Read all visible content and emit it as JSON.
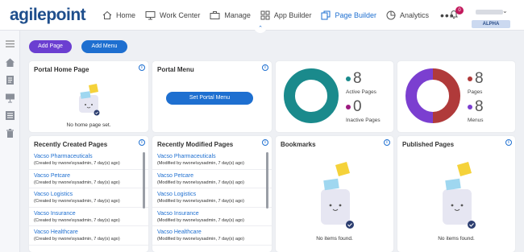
{
  "app": {
    "logo_text": "agilepoint",
    "logo_dot_color": "#1e4e8c"
  },
  "nav": {
    "items": [
      {
        "label": "Home",
        "icon": "home-icon",
        "active": false
      },
      {
        "label": "Work Center",
        "icon": "monitor-icon",
        "active": false
      },
      {
        "label": "Manage",
        "icon": "briefcase-icon",
        "active": false
      },
      {
        "label": "App Builder",
        "icon": "grid-icon",
        "active": false
      },
      {
        "label": "Page Builder",
        "icon": "pages-icon",
        "active": true
      },
      {
        "label": "Analytics",
        "icon": "pie-icon",
        "active": false
      }
    ],
    "more": "•••",
    "notification_count": "0",
    "user_role": "ALPHA"
  },
  "toolbar": {
    "add_page": "Add Page",
    "add_menu": "Add Menu"
  },
  "portal_home": {
    "title": "Portal Home Page",
    "empty": "No home page set."
  },
  "portal_menu": {
    "title": "Portal Menu",
    "button": "Set Portal Menu"
  },
  "pages_stats": {
    "active": "8",
    "active_label": "Active Pages",
    "inactive": "0",
    "inactive_label": "Inactive Pages",
    "ring_color": "#1a8a8c",
    "active_color": "#1a8a8c",
    "inactive_color": "#9c1a7f"
  },
  "menus_stats": {
    "pages": "8",
    "pages_label": "Pages",
    "menus": "8",
    "menus_label": "Menus",
    "pages_color": "#b03a3a",
    "menus_color": "#7b3fd0",
    "pages_fraction": 0.5
  },
  "recent_created": {
    "title": "Recently Created Pages",
    "items": [
      {
        "name": "Vacso Pharmaceuticals",
        "meta": "(Created by nwone\\sysadmin, 7 day(s) ago)"
      },
      {
        "name": "Vacso Petcare",
        "meta": "(Created by nwone\\sysadmin, 7 day(s) ago)"
      },
      {
        "name": "Vacso Logistics",
        "meta": "(Created by nwone\\sysadmin, 7 day(s) ago)"
      },
      {
        "name": "Vacso Insurance",
        "meta": "(Created by nwone\\sysadmin, 7 day(s) ago)"
      },
      {
        "name": "Vacso Healthcare",
        "meta": "(Created by nwone\\sysadmin, 7 day(s) ago)"
      }
    ]
  },
  "recent_modified": {
    "title": "Recently Modified Pages",
    "items": [
      {
        "name": "Vacso Pharmaceuticals",
        "meta": "(Modified by nwone\\sysadmin, 7 day(s) ago)"
      },
      {
        "name": "Vacso Petcare",
        "meta": "(Modified by nwone\\sysadmin, 7 day(s) ago)"
      },
      {
        "name": "Vacso Logistics",
        "meta": "(Modified by nwone\\sysadmin, 7 day(s) ago)"
      },
      {
        "name": "Vacso Insurance",
        "meta": "(Modified by nwone\\sysadmin, 7 day(s) ago)"
      },
      {
        "name": "Vacso Healthcare",
        "meta": "(Modified by nwone\\sysadmin, 7 day(s) ago)"
      }
    ]
  },
  "bookmarks": {
    "title": "Bookmarks",
    "empty": "No items found."
  },
  "published": {
    "title": "Published Pages",
    "empty": "No items found."
  },
  "info_symbol": "i"
}
